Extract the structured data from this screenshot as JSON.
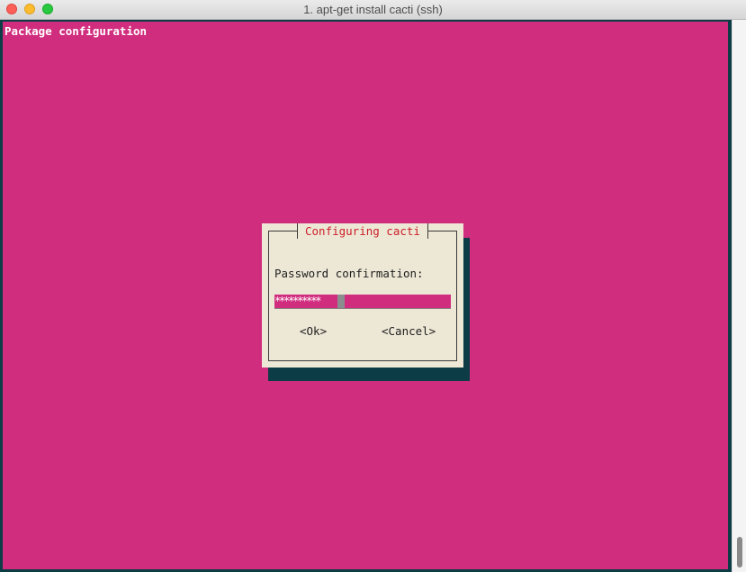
{
  "window": {
    "title": "1. apt-get install cacti (ssh)"
  },
  "terminal": {
    "backtitle": "Package configuration",
    "background_color": "#d12d7e",
    "frame_color": "#0c3c45"
  },
  "dialog": {
    "title": "Configuring cacti",
    "prompt": "Password confirmation:",
    "password_mask": "**********",
    "buttons": {
      "ok": "<Ok>",
      "cancel": "<Cancel>"
    },
    "background_color": "#ede7d5",
    "title_color": "#cc1f2a"
  }
}
